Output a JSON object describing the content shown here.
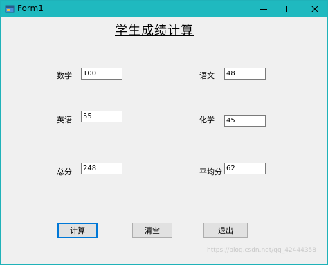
{
  "window": {
    "title": "Form1"
  },
  "form": {
    "heading": "学生成绩计算",
    "fields": {
      "math": {
        "label": "数学",
        "value": "100"
      },
      "chinese": {
        "label": "语文",
        "value": "48"
      },
      "english": {
        "label": "英语",
        "value": "55"
      },
      "chemistry": {
        "label": "化学",
        "value": "45"
      },
      "total": {
        "label": "总分",
        "value": "248"
      },
      "average": {
        "label": "平均分",
        "value": "62"
      }
    },
    "buttons": {
      "calculate": "计算",
      "clear": "清空",
      "exit": "退出"
    }
  },
  "watermark": "https://blog.csdn.net/qq_42444358",
  "colors": {
    "titlebar": "#1fb9bf",
    "client_bg": "#f0f0f0",
    "default_button_border": "#0078d7"
  },
  "icons": [
    "app-icon",
    "minimize-icon",
    "maximize-icon",
    "close-icon"
  ]
}
